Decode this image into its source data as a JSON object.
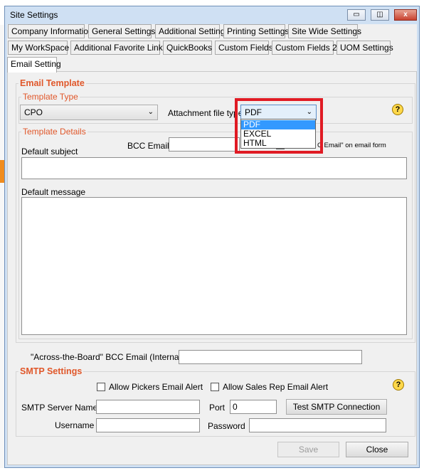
{
  "window": {
    "title": "Site Settings",
    "minimize_label": "▭",
    "restore_label": "◫",
    "close_label": "x"
  },
  "tabs_row1": [
    "Company Information",
    "General Settings",
    "Additional Setting",
    "Printing Settings",
    "Site Wide Settings"
  ],
  "tabs_row2": [
    "My WorkSpace",
    "Additional Favorite Links",
    "QuickBooks",
    "Custom Fields",
    "Custom Fields 2",
    "UOM Settings"
  ],
  "tabs_row3": [
    "Email Setting"
  ],
  "email_template": {
    "legend": "Email Template",
    "template_type": {
      "legend": "Template Type",
      "value": "CPO",
      "attachment_label": "Attachment file type",
      "attachment_value": "PDF",
      "attachment_options": [
        "PDF",
        "EXCEL",
        "HTML"
      ],
      "help": "?"
    },
    "template_details": {
      "legend": "Template Details",
      "default_subject_label": "Default subject",
      "bcc_email_label": "BCC Email",
      "bcc_checkbox_label_partial": "C Email\" on email form",
      "default_message_label": "Default message"
    }
  },
  "across_board": {
    "label": "\"Across-the-Board\" BCC Email (Internal)",
    "value": ""
  },
  "smtp": {
    "legend": "SMTP Settings",
    "allow_pickers_label": "Allow Pickers Email Alert",
    "allow_sales_rep_label": "Allow Sales Rep Email Alert",
    "server_name_label": "SMTP Server Name",
    "server_name_value": "",
    "port_label": "Port",
    "port_value": "0",
    "test_button": "Test SMTP Connection",
    "username_label": "Username",
    "password_label": "Password",
    "help": "?"
  },
  "footer": {
    "save_label": "Save",
    "close_label": "Close"
  },
  "colors": {
    "legend": "#e0572a",
    "highlight": "#e01b24",
    "selected": "#3399ff"
  }
}
